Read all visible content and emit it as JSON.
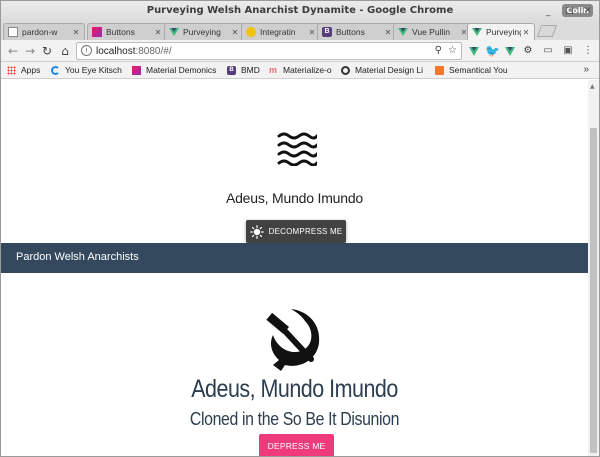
{
  "window": {
    "title": "Purveying Welsh Anarchist Dynamite - Google Chrome",
    "profile_chip": "Colin"
  },
  "tabs": [
    {
      "label": "pardon-w",
      "icon": "page-icon",
      "color": "#ffffff"
    },
    {
      "label": "Buttons",
      "icon": "materialize-icon",
      "color": "#9c27b0"
    },
    {
      "label": "Purveying",
      "icon": "vue-icon",
      "color": "#41b883"
    },
    {
      "label": "Integratin",
      "icon": "github-icon",
      "color": "#f1c40f"
    },
    {
      "label": "Buttons",
      "icon": "bootstrap-icon",
      "color": "#563d7c"
    },
    {
      "label": "Vue Pullin",
      "icon": "vue-icon",
      "color": "#41b883"
    },
    {
      "label": "Purveying",
      "icon": "vue-icon",
      "color": "#41b883"
    }
  ],
  "toolbar": {
    "url_host": "localhost",
    "url_rest": ":8080/#/"
  },
  "bookmarks": [
    {
      "label": "Apps",
      "icon": "apps-icon",
      "color": "#e53935"
    },
    {
      "label": "You Eye Kitsch",
      "icon": "refresh-icon",
      "color": "#1e88e5"
    },
    {
      "label": "Material Demonics",
      "icon": "materialize-icon",
      "color": "#9c27b0"
    },
    {
      "label": "BMD",
      "icon": "bootstrap-icon",
      "color": "#563d7c"
    },
    {
      "label": "Materialize-o",
      "icon": "materialize-m-icon",
      "color": "#ee6e73"
    },
    {
      "label": "Material Design Li",
      "icon": "material-design-icon",
      "color": "#333333"
    },
    {
      "label": "Semantical You",
      "icon": "semantic-icon",
      "color": "#f4772c"
    }
  ],
  "page": {
    "hero_title": "Adeus, Mundo Imundo",
    "decompress_label": "DECOMPRESS ME",
    "navbar_brand": "Pardon Welsh Anarchists",
    "main_title": "Adeus, Mundo Imundo",
    "main_subtitle": "Cloned in the So Be It Disunion",
    "depress_label": "DEPRESS ME"
  },
  "colors": {
    "navbar": "#34495e",
    "decompress_button": "#424242",
    "depress_button": "#ef3a7b",
    "title_text": "#2c3e50"
  }
}
